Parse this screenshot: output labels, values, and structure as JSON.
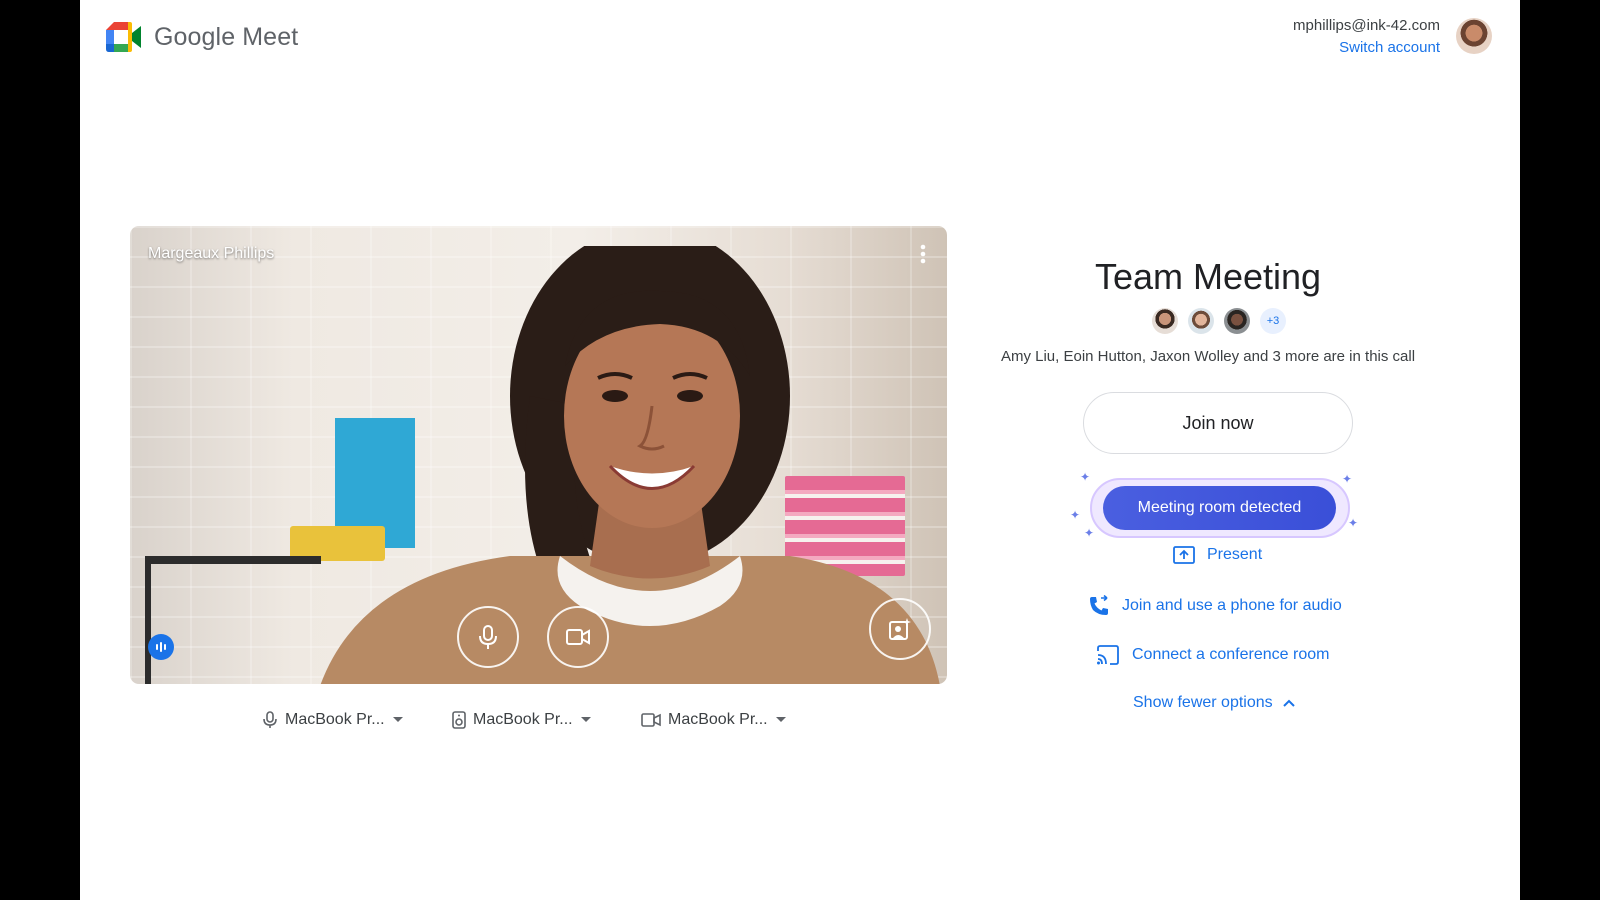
{
  "header": {
    "app_name": "Google Meet",
    "account_email": "mphillips@ink-42.com",
    "switch_account": "Switch account"
  },
  "preview": {
    "user_name": "Margeaux Phillips",
    "mic_icon": "mic-icon",
    "camera_icon": "camera-icon",
    "effects_icon": "visual-effects-icon"
  },
  "devices": {
    "microphone": "MacBook Pr...",
    "speaker": "MacBook Pr...",
    "camera": "MacBook Pr..."
  },
  "meeting": {
    "title": "Team Meeting",
    "more_count": "+3",
    "in_call_text": "Amy Liu, Eoin Hutton, Jaxon Wolley and 3 more are in this call",
    "join_now": "Join now",
    "room_detected": "Meeting room detected",
    "present": "Present",
    "phone_audio": "Join and use a phone for audio",
    "conference_room": "Connect a conference room",
    "fewer_options": "Show fewer options"
  },
  "colors": {
    "accent": "#1a73e8",
    "detect_button": "#4a5fe0"
  }
}
